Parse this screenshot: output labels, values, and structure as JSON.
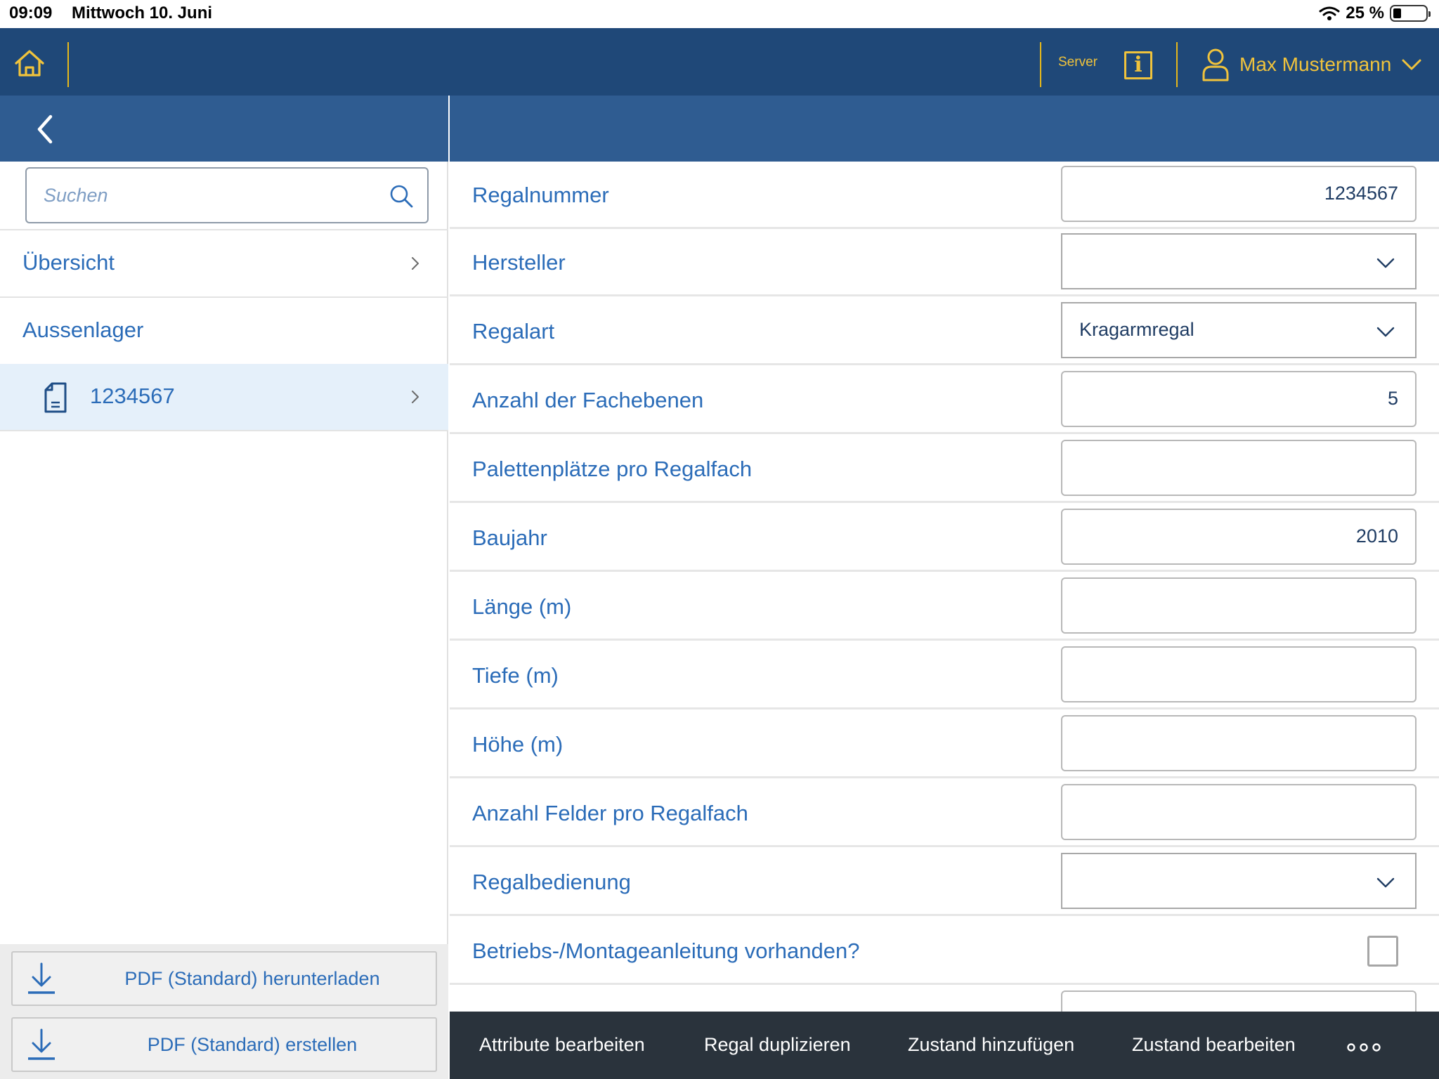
{
  "status_bar": {
    "time": "09:09",
    "date": "Mittwoch 10. Juni",
    "battery": "25 %",
    "battery_level": 0.25
  },
  "top_nav": {
    "home_icon": "home-icon",
    "server_label": "Server",
    "info_icon": "info-icon",
    "info_glyph": "i",
    "user_icon": "user-icon",
    "user_name": "Max Mustermann",
    "accent_color": "#f0c33c",
    "background_color": "#1f4878"
  },
  "sidebar": {
    "search_placeholder": "Suchen",
    "items": [
      {
        "label": "Übersicht"
      },
      {
        "label": "Aussenlager"
      },
      {
        "label": "1234567"
      }
    ],
    "buttons": [
      {
        "label": "PDF (Standard) herunterladen"
      },
      {
        "label": "PDF (Standard) erstellen"
      }
    ]
  },
  "form": {
    "fields": [
      {
        "label": "Regalnummer",
        "type": "text",
        "value": "1234567"
      },
      {
        "label": "Hersteller",
        "type": "dropdown",
        "value": ""
      },
      {
        "label": "Regalart",
        "type": "dropdown",
        "value": "Kragarmregal"
      },
      {
        "label": "Anzahl der Fachebenen",
        "type": "text",
        "value": "5"
      },
      {
        "label": "Palettenplätze pro Regalfach",
        "type": "text",
        "value": ""
      },
      {
        "label": "Baujahr",
        "type": "text",
        "value": "2010"
      },
      {
        "label": "Länge (m)",
        "type": "text",
        "value": ""
      },
      {
        "label": "Tiefe (m)",
        "type": "text",
        "value": ""
      },
      {
        "label": "Höhe (m)",
        "type": "text",
        "value": ""
      },
      {
        "label": "Anzahl Felder pro Regalfach",
        "type": "text",
        "value": ""
      },
      {
        "label": "Regalbedienung",
        "type": "dropdown",
        "value": ""
      },
      {
        "label": "Betriebs-/Montageanleitung vorhanden?",
        "type": "checkbox",
        "checked": false
      }
    ]
  },
  "toolbar": {
    "actions": [
      {
        "label": "Attribute bearbeiten"
      },
      {
        "label": "Regal duplizieren"
      },
      {
        "label": "Zustand hinzufügen"
      },
      {
        "label": "Zustand bearbeiten"
      }
    ],
    "more_icon": "more-icon"
  }
}
